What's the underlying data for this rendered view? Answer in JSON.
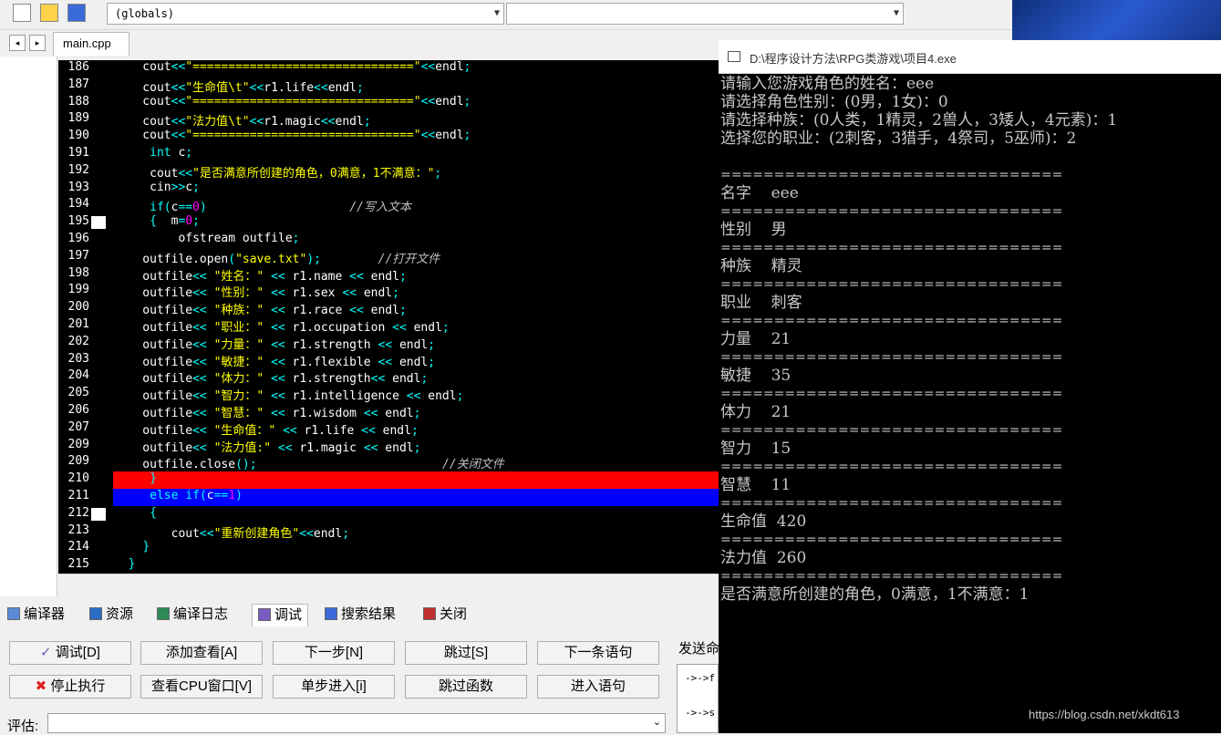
{
  "toolbar": {
    "icons": [
      "step-out-icon",
      "insert-icon",
      "bookmark-icon"
    ],
    "globals_combo": "(globals)",
    "members_combo": ""
  },
  "tabs": {
    "nav_left": "◂",
    "nav_right": "▸",
    "file": "main.cpp"
  },
  "editor": {
    "lines": [
      {
        "num": "186",
        "code": "    cout<<\"===============================\"<<endl;"
      },
      {
        "num": "187",
        "code": "    cout<<\"生命值\\t\"<<r1.life<<endl;"
      },
      {
        "num": "188",
        "code": "    cout<<\"===============================\"<<endl;"
      },
      {
        "num": "189",
        "code": "    cout<<\"法力值\\t\"<<r1.magic<<endl;"
      },
      {
        "num": "190",
        "code": "    cout<<\"===============================\"<<endl;"
      },
      {
        "num": "191",
        "code": "     int c;"
      },
      {
        "num": "192",
        "code": "     cout<<\"是否满意所创建的角色，0满意，1不满意：\";"
      },
      {
        "num": "193",
        "code": "     cin>>c;"
      },
      {
        "num": "194",
        "code": "     if(c==0)                    //写入文本"
      },
      {
        "num": "195",
        "code": "     {  m=0;"
      },
      {
        "num": "196",
        "code": "         ofstream outfile;"
      },
      {
        "num": "197",
        "code": "    outfile.open(\"save.txt\");        //打开文件"
      },
      {
        "num": "198",
        "code": "    outfile<< \"姓名：\" << r1.name << endl;"
      },
      {
        "num": "199",
        "code": "    outfile<< \"性别：\" << r1.sex << endl;"
      },
      {
        "num": "200",
        "code": "    outfile<< \"种族：\" << r1.race << endl;"
      },
      {
        "num": "201",
        "code": "    outfile<< \"职业：\" << r1.occupation << endl;"
      },
      {
        "num": "202",
        "code": "    outfile<< \"力量：\" << r1.strength << endl;"
      },
      {
        "num": "203",
        "code": "    outfile<< \"敏捷：\" << r1.flexible << endl;"
      },
      {
        "num": "204",
        "code": "    outfile<< \"体力：\" << r1.strength<< endl;"
      },
      {
        "num": "205",
        "code": "    outfile<< \"智力：\" << r1.intelligence << endl;"
      },
      {
        "num": "206",
        "code": "    outfile<< \"智慧：\" << r1.wisdom << endl;"
      },
      {
        "num": "207",
        "code": "    outfile<< \"生命值：\" << r1.life << endl;"
      },
      {
        "num": "209",
        "code": "    outfile<< \"法力值:\" << r1.magic << endl;"
      },
      {
        "num": "209",
        "code": "    outfile.close();                          //关闭文件"
      },
      {
        "num": "210",
        "code": "     }"
      },
      {
        "num": "211",
        "code": "     else if(c==1)"
      },
      {
        "num": "212",
        "code": "     {"
      },
      {
        "num": "213",
        "code": "        cout<<\"重新创建角色\"<<endl;"
      },
      {
        "num": "214",
        "code": "    }"
      },
      {
        "num": "215",
        "code": "  }"
      }
    ],
    "breakpoint_line": "210",
    "current_line": "211"
  },
  "console": {
    "title": "D:\\程序设计方法\\RPG类游戏\\项目4.exe",
    "lines": [
      "请输入您游戏角色的姓名：eee",
      "请选择角色性别：(0男，1女)：0",
      "请选择种族：(0人类，1精灵，2兽人，3矮人，4元素)：1",
      "选择您的职业：(2刺客，3猎手，4祭司，5巫师)：2",
      "",
      "================================",
      "名字    eee",
      "================================",
      "性别    男",
      "================================",
      "种族    精灵",
      "================================",
      "职业    刺客",
      "================================",
      "力量    21",
      "================================",
      "敏捷    35",
      "================================",
      "体力    21",
      "================================",
      "智力    15",
      "================================",
      "智慧    11",
      "================================",
      "生命值  420",
      "================================",
      "法力值  260",
      "================================",
      "是否满意所创建的角色，0满意，1不满意：1"
    ],
    "watermark": "https://blog.csdn.net/xkdt613"
  },
  "bottom_tabs": [
    "编译器",
    "资源",
    "编译日志",
    "调试",
    "搜索结果",
    "关闭"
  ],
  "bottom_tab_icons": [
    "compiler-icon",
    "resources-icon",
    "compile-log-icon",
    "debug-icon",
    "search-results-icon",
    "close-icon"
  ],
  "debug_buttons": {
    "row1": [
      "调试[D]",
      "添加查看[A]",
      "下一步[N]",
      "跳过[S]",
      "下一条语句"
    ],
    "row2": [
      "停止执行",
      "查看CPU窗口[V]",
      "单步进入[i]",
      "跳过函数",
      "进入语句"
    ]
  },
  "send": {
    "label": "发送命",
    "lines": [
      "->->f",
      "->->s"
    ]
  },
  "eval": {
    "label": "评估:",
    "value": ""
  }
}
